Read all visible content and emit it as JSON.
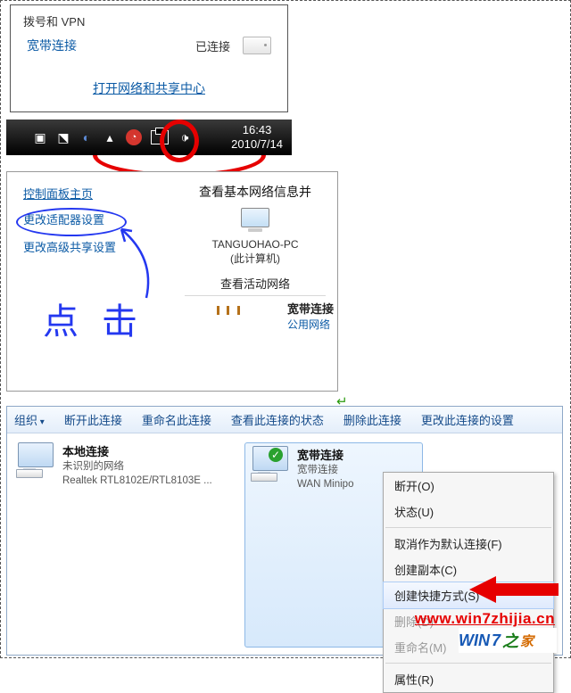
{
  "panel1": {
    "section": "拨号和 VPN",
    "conn_name": "宽带连接",
    "conn_status": "已连接",
    "link": "打开网络和共享中心"
  },
  "taskbar": {
    "time": "16:43",
    "date": "2010/7/14"
  },
  "panel2": {
    "left": {
      "home": "控制面板主页",
      "adapter": "更改适配器设置",
      "sharing": "更改高级共享设置",
      "handwrite": "点 击"
    },
    "right": {
      "title": "查看基本网络信息并",
      "pcname": "TANGUOHAO-PC",
      "pcsub": "(此计算机)",
      "section": "查看活动网络",
      "conn_name": "宽带连接",
      "conn_type": "公用网络"
    }
  },
  "panel3": {
    "toolbar": {
      "org": "组织",
      "disconnect": "断开此连接",
      "rename": "重命名此连接",
      "status": "查看此连接的状态",
      "delete": "删除此连接",
      "settings": "更改此连接的设置"
    },
    "item1": {
      "title": "本地连接",
      "sub1": "未识别的网络",
      "sub2": "Realtek RTL8102E/RTL8103E ..."
    },
    "item2": {
      "title": "宽带连接",
      "sub1": "宽带连接",
      "sub2": "WAN Minipo"
    },
    "menu": {
      "m1": "断开(O)",
      "m2": "状态(U)",
      "m3": "取消作为默认连接(F)",
      "m4": "创建副本(C)",
      "m5": "创建快捷方式(S)",
      "m6": "删除(D)",
      "m7": "重命名(M)",
      "m8": "属性(R)"
    },
    "watermark": "www.win7zhijia.cn",
    "logo_win": "WIN",
    "logo_7": "7",
    "logo_z": "之",
    "logo_j": "家"
  }
}
